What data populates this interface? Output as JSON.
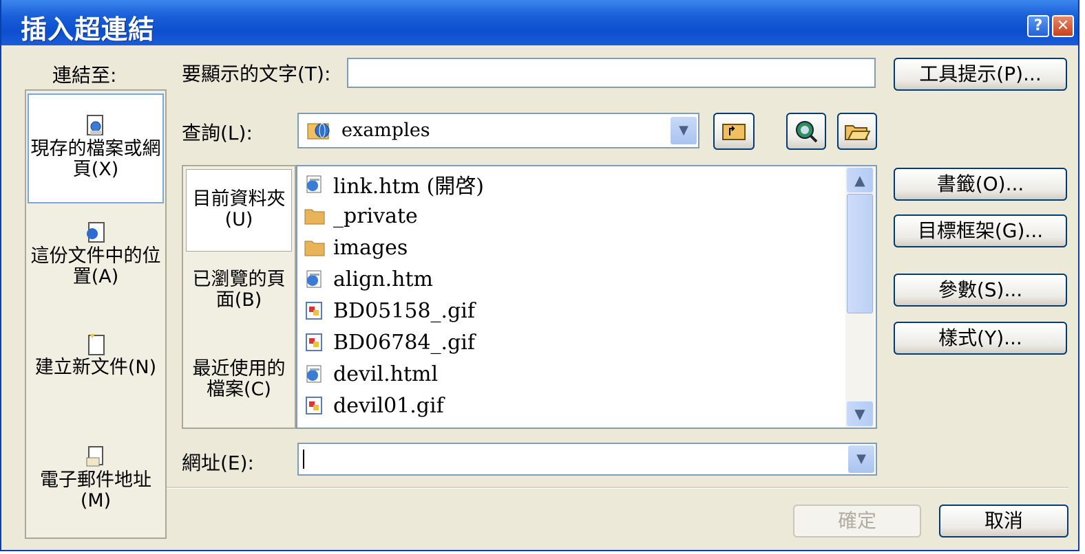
{
  "dialog": {
    "title": "插入超連結",
    "help_icon_glyph": "?",
    "close_icon_glyph": "✕"
  },
  "link_to": {
    "label": "連結至:",
    "items": [
      {
        "label": "現存的檔案或網頁(X)",
        "icon": "existing-file-icon",
        "selected": true
      },
      {
        "label": "這份文件中的位置(A)",
        "icon": "place-in-document-icon",
        "selected": false
      },
      {
        "label": "建立新文件(N)",
        "icon": "new-document-icon",
        "selected": false
      },
      {
        "label": "電子郵件地址(M)",
        "icon": "email-address-icon",
        "selected": false
      }
    ]
  },
  "display_text": {
    "label": "要顯示的文字(T):",
    "value": ""
  },
  "screentip_button": "工具提示(P)...",
  "look_in": {
    "label": "查詢(L):",
    "value": "examples"
  },
  "tabs": [
    {
      "label": "目前資料夾(U)",
      "selected": true
    },
    {
      "label": "已瀏覽的頁面(B)",
      "selected": false
    },
    {
      "label": "最近使用的檔案(C)",
      "selected": false
    }
  ],
  "files": [
    {
      "name": "link.htm (開啓)",
      "type": "html"
    },
    {
      "name": "_private",
      "type": "folder"
    },
    {
      "name": "images",
      "type": "folder"
    },
    {
      "name": "align.htm",
      "type": "html"
    },
    {
      "name": "BD05158_.gif",
      "type": "gif"
    },
    {
      "name": "BD06784_.gif",
      "type": "gif"
    },
    {
      "name": "devil.html",
      "type": "html"
    },
    {
      "name": "devil01.gif",
      "type": "gif"
    }
  ],
  "side_buttons": {
    "bookmark": "書籤(O)...",
    "target_frame": "目標框架(G)...",
    "parameters": "參數(S)...",
    "style": "樣式(Y)..."
  },
  "address": {
    "label": "網址(E):",
    "value": ""
  },
  "ok_button": "確定",
  "cancel_button": "取消"
}
